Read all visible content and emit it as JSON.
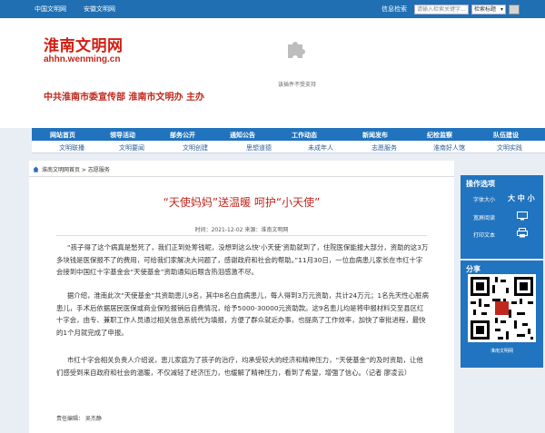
{
  "topbar": {
    "link1": "中国文明网",
    "link2": "安徽文明网",
    "login": "信息检索",
    "search_placeholder": "请输入检索关键字...",
    "select_value": "检索标题",
    "bg": "#1f6fb2"
  },
  "header": {
    "logo_cn": "淮南文明网",
    "logo_en": "ahhn.wenming.cn",
    "plugin_text": "该插件不受支持",
    "sponsor": "中共淮南市委宣传部 淮南市文明办 主办"
  },
  "nav_primary": [
    "网站首页",
    "领导活动",
    "部务公开",
    "通知公告",
    "工作动态",
    "新闻发布",
    "纪检监察",
    "队伍建设"
  ],
  "nav_secondary": [
    "文明联播",
    "文明要闻",
    "文明创建",
    "思想道德",
    "未成年人",
    "志愿服务",
    "淮南好人馆",
    "文明实践"
  ],
  "breadcrumb": "淮南文明网首页 > 志愿服务",
  "article": {
    "title": "“天使妈妈”送温暖 呵护“小天使”",
    "meta": "时间：2021-12-02    来源：淮南文明网",
    "p1": "“孩子得了这个病真是愁死了，我们正到处筹钱呢，没想到这么快‘小天使’资助就到了，住院医保能报大部分，资助的这3万多块钱是医保报不了的费用，可给我们家解决大问题了，感谢政府和社会的帮助。”11月30日，一位血病患儿家长在市红十字会接到中国红十字基金会“天使基金”资助通知后眼含热泪感激不尽。",
    "p2": "据介绍，淮南此次“天使基金”共资助患儿9名，其中8名白血病患儿，每人得到3万元资助，共计24万元；1名先天性心脏病患儿，手术后依据居民医保或商业保险报销后自费情况，给予5000-30000元资助款。这9名患儿均是将申报材料交至县区红十字会，由专、兼职工作人员通过相关信息系统代为填报，方便了群众就近办事，也提高了工作效率，加快了审批进程，最快的1个月就完成了申报。",
    "p3": "市红十字会相关负责人介绍说，患儿家庭为了孩子的治疗，均承受较大的经济和精神压力，“天使基金”的及时资助，让他们感受到来自政府和社会的温暖，不仅减轻了经济压力，也缓解了精神压力，看到了希望，增强了信心。（记者 廖凌云）",
    "editor": "责任编辑： 吴杰静"
  },
  "sidebar": {
    "ops_title": "操作选项",
    "font_label": "字体大小",
    "font_sizes": "大 中 小",
    "wide_label": "宽屏阅读",
    "print_label": "打印文本",
    "share_title": "分享",
    "qr_caption": "淮南文明网",
    "bg": "#2174bf"
  }
}
